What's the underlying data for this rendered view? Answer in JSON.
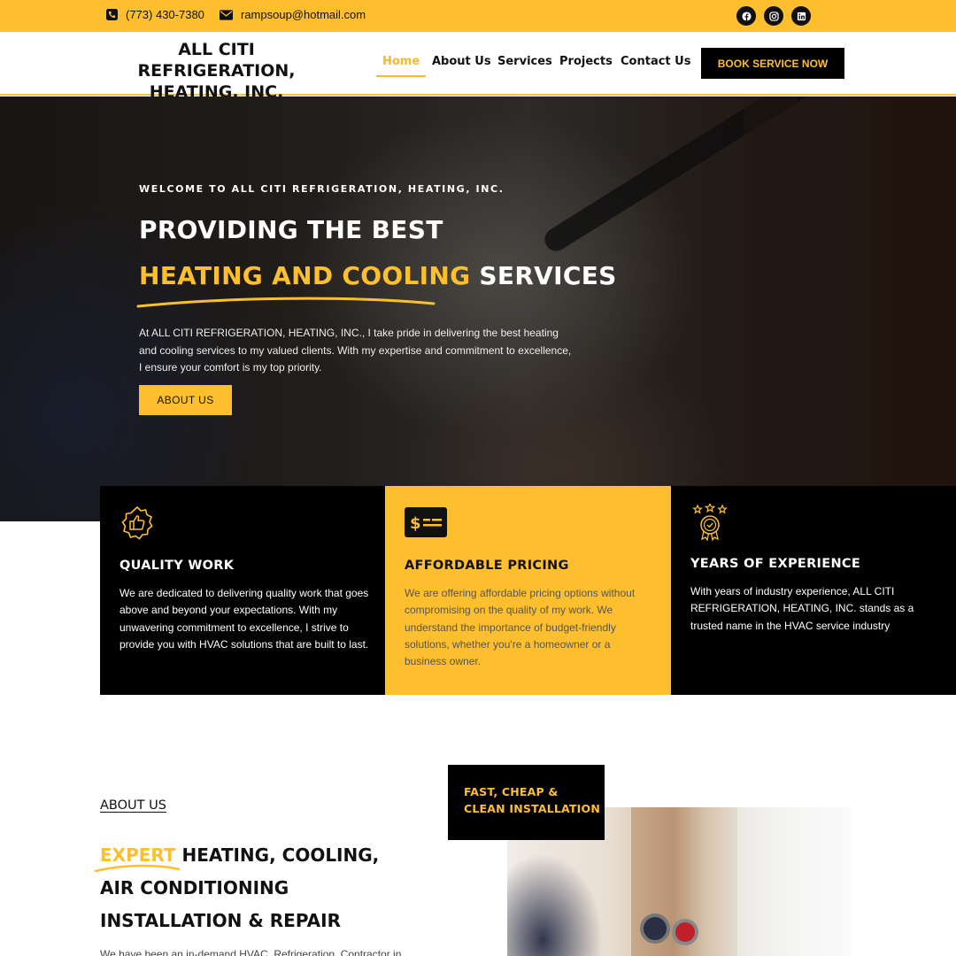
{
  "topbar": {
    "phone": "(773) 430-7380",
    "email": "rampsoup@hotmail.com",
    "social": [
      "facebook-icon",
      "instagram-icon",
      "linkedin-icon"
    ]
  },
  "header": {
    "logo_line1": "ALL CITI REFRIGERATION,",
    "logo_line2": "HEATING, INC.",
    "nav": [
      {
        "label": "Home",
        "active": true
      },
      {
        "label": "About Us",
        "active": false
      },
      {
        "label": "Services",
        "active": false
      },
      {
        "label": "Projects",
        "active": false
      },
      {
        "label": "Contact Us",
        "active": false
      }
    ],
    "cta": "BOOK SERVICE NOW"
  },
  "hero": {
    "kicker": "WELCOME TO ALL CITI REFRIGERATION, HEATING, INC.",
    "title_line1": "PROVIDING THE BEST",
    "title_highlight": "HEATING AND COOLING",
    "title_rest": " SERVICES",
    "paragraph": "At ALL CITI REFRIGERATION, HEATING, INC., I take pride in delivering the best heating and cooling services to my valued clients. With my expertise and commitment to excellence, I ensure your comfort is my top priority.",
    "button": "ABOUT US"
  },
  "features": [
    {
      "icon": "quality-badge-icon",
      "title": "QUALITY WORK",
      "text": "We are dedicated to delivering quality work that goes above and beyond your expectations. With my unwavering commitment to excellence, I strive to provide you with HVAC solutions that are built to last."
    },
    {
      "icon": "price-tag-icon",
      "title": "AFFORDABLE PRICING",
      "text": "We are offering affordable pricing options without compromising on the quality of my work. We understand the importance of budget-friendly solutions, whether you're a homeowner or a business owner."
    },
    {
      "icon": "award-medal-icon",
      "title": "YEARS OF EXPERIENCE",
      "text": "With years of industry experience, ALL CITI REFRIGERATION, HEATING, INC. stands as a trusted name in the HVAC service industry"
    }
  ],
  "about": {
    "kicker": "ABOUT US",
    "title_highlight": "EXPERT",
    "title_rest": " HEATING, COOLING, AIR CONDITIONING INSTALLATION & REPAIR",
    "paragraph": "We have been an in-demand HVAC, Refrigeration, Contractor in",
    "badge_line1": "FAST, CHEAP &",
    "badge_line2": "CLEAN INSTALLATION"
  },
  "colors": {
    "accent": "#fdbf2d",
    "dark": "#000000"
  }
}
